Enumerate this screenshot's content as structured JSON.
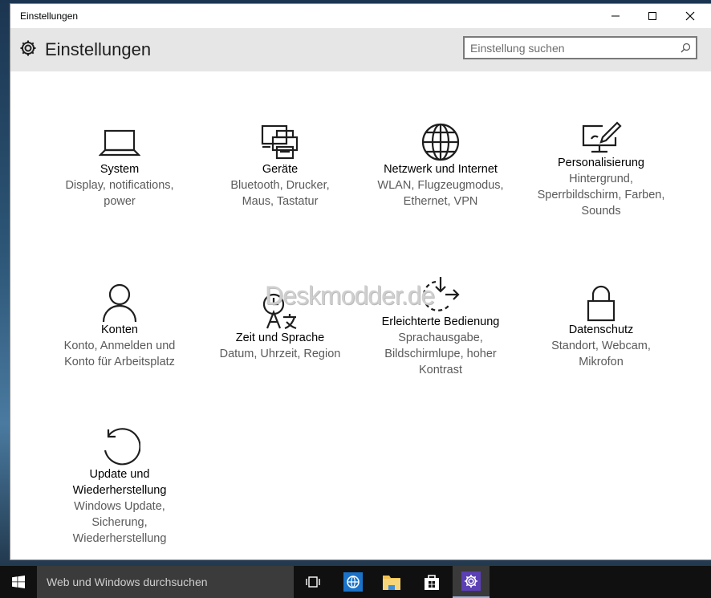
{
  "window": {
    "title": "Einstellungen",
    "minimize_label": "",
    "maximize_label": "",
    "close_label": ""
  },
  "header": {
    "app_title": "Einstellungen",
    "search_placeholder": "Einstellung suchen"
  },
  "tiles": [
    {
      "name": "System",
      "desc": [
        "Display, notifications,",
        "power"
      ],
      "icon": "laptop-icon"
    },
    {
      "name": "Geräte",
      "desc": [
        "Bluetooth, Drucker,",
        "Maus, Tastatur"
      ],
      "icon": "devices-icon"
    },
    {
      "name": "Netzwerk und Internet",
      "desc": [
        "WLAN, Flugzeugmodus,",
        "Ethernet, VPN"
      ],
      "icon": "globe-icon"
    },
    {
      "name": "Personalisierung",
      "desc": [
        "Hintergrund,",
        "Sperrbildschirm, Farben,",
        "Sounds"
      ],
      "icon": "paint-monitor-icon"
    },
    {
      "name": "Konten",
      "desc": [
        "Konto, Anmelden und",
        "Konto für Arbeitsplatz"
      ],
      "icon": "person-icon"
    },
    {
      "name": "Zeit und Sprache",
      "desc": [
        "Datum, Uhrzeit, Region"
      ],
      "icon": "time-language-icon"
    },
    {
      "name": "Erleichterte Bedienung",
      "desc": [
        "Sprachausgabe,",
        "Bildschirmlupe, hoher",
        "Kontrast"
      ],
      "icon": "ease-of-access-icon"
    },
    {
      "name": "Datenschutz",
      "desc": [
        "Standort, Webcam,",
        "Mikrofon"
      ],
      "icon": "lock-icon"
    },
    {
      "name": "Update und",
      "name2": "Wiederherstellung",
      "desc": [
        "Windows Update,",
        "Sicherung,",
        "Wiederherstellung"
      ],
      "icon": "update-icon"
    }
  ],
  "watermark": "Deskmodder.de",
  "taskbar": {
    "search_placeholder": "Web und Windows durchsuchen"
  },
  "colors": {
    "header_bg": "#e6e6e6",
    "taskbar_bg": "#101010",
    "accent_purple": "#5b3fb5",
    "edge_blue": "#1a73c9",
    "explorer_yellow": "#f2c14e"
  }
}
